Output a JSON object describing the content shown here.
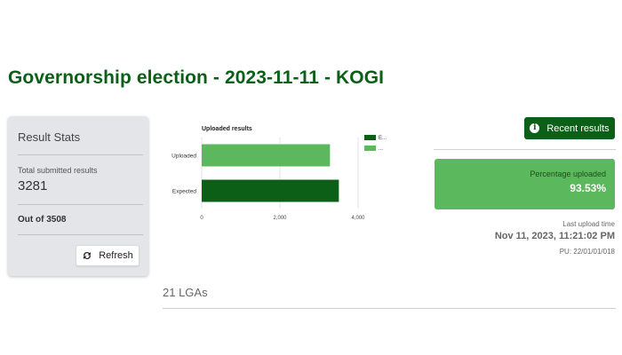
{
  "page": {
    "title": "Governorship election - 2023-11-11 - KOGI"
  },
  "stats": {
    "title": "Result Stats",
    "submitted_label": "Total submitted results",
    "submitted_value": "3281",
    "out_of": "Out of 3508",
    "refresh_label": "Refresh",
    "refresh_icon": "refresh-icon"
  },
  "colors": {
    "brand_dark_green": "#0b5f17",
    "uploaded_green": "#5cb85c",
    "card_gray": "#e3e5e8"
  },
  "chart_data": {
    "type": "bar",
    "orientation": "horizontal",
    "title": "Uploaded results",
    "categories": [
      "Uploaded",
      "Expected"
    ],
    "values": [
      3281,
      3508
    ],
    "colors": [
      "#5cb85c",
      "#0b5f17"
    ],
    "xlim": [
      0,
      4000
    ],
    "xticks": [
      0,
      2000,
      4000
    ],
    "xtick_labels": [
      "0",
      "2,000",
      "4,000"
    ],
    "legend": {
      "placement": "right",
      "entries": [
        {
          "label": "E...",
          "color": "#0b5f17"
        },
        {
          "label": "...",
          "color": "#5cb85c"
        }
      ]
    },
    "grid": "vertical"
  },
  "recent": {
    "button_label": "Recent results",
    "icon": "info-icon"
  },
  "percentage": {
    "label": "Percentage uploaded",
    "value": "93.53%"
  },
  "upload": {
    "label": "Last upload time",
    "time": "Nov 11, 2023, 11:21:02 PM",
    "pu": "PU: 22/01/01/018"
  },
  "lga": {
    "count_label": "21 LGAs"
  }
}
